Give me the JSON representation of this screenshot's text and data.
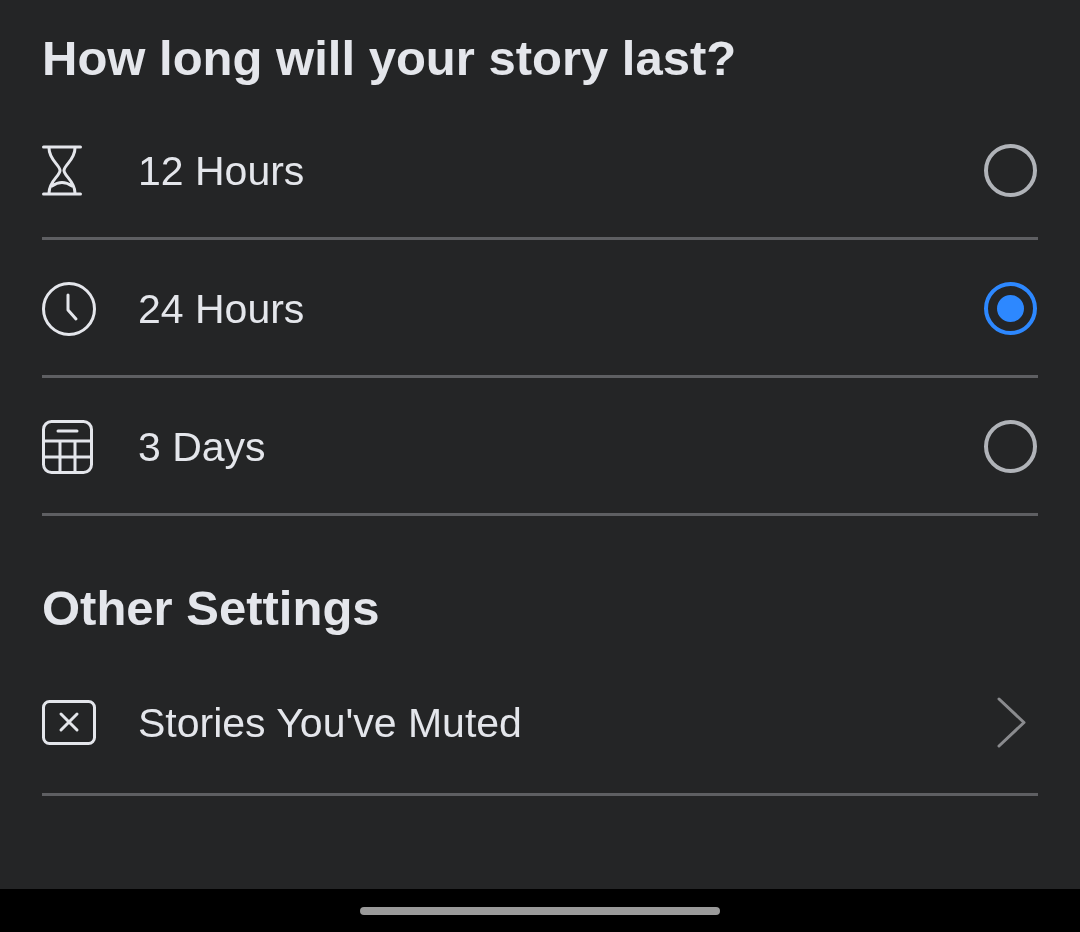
{
  "title": "How long will your story last?",
  "duration_options": [
    {
      "label": "12 Hours",
      "selected": false
    },
    {
      "label": "24 Hours",
      "selected": true
    },
    {
      "label": "3 Days",
      "selected": false
    }
  ],
  "other_settings": {
    "heading": "Other Settings",
    "items": [
      {
        "label": "Stories You've Muted"
      }
    ]
  }
}
